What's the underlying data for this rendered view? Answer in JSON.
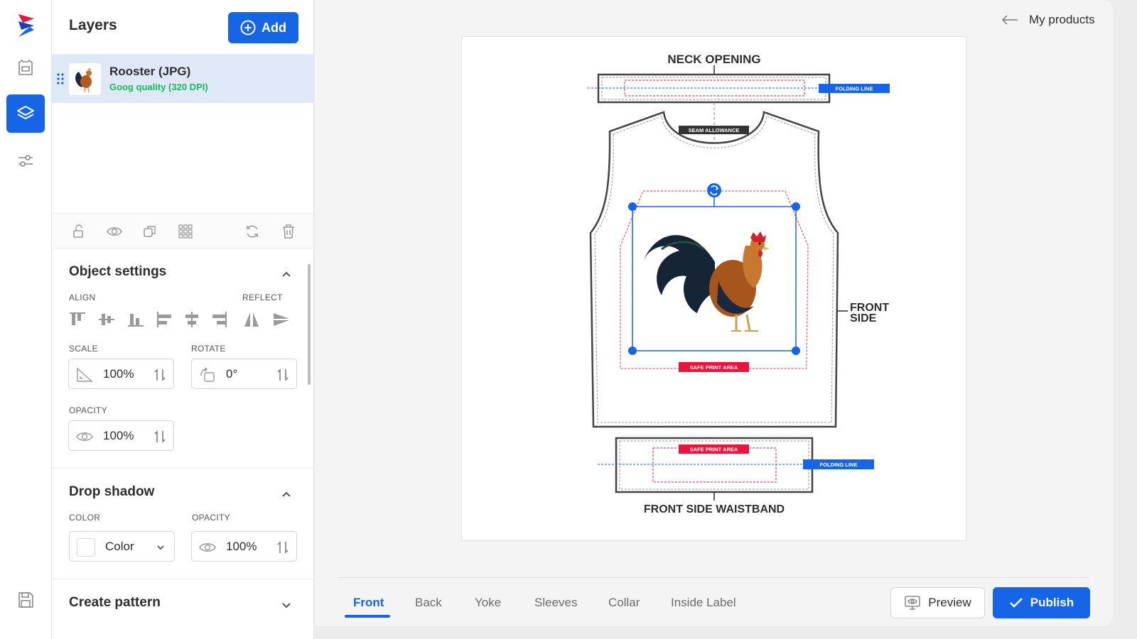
{
  "app": {
    "brand_colors": {
      "primary": "#1565e6",
      "accent_red": "#e8163c",
      "success": "#1bb954"
    }
  },
  "rail": {
    "items": [
      "logo",
      "products-icon",
      "layers-icon",
      "settings-sliders-icon",
      "save-icon"
    ],
    "active": "layers"
  },
  "layers": {
    "title": "Layers",
    "add_label": "Add",
    "items": [
      {
        "name": "Rooster (JPG)",
        "quality": "Goog quality (320 DPI)"
      }
    ]
  },
  "object_settings": {
    "title": "Object settings",
    "align_label": "ALIGN",
    "reflect_label": "REFLECT",
    "scale_label": "SCALE",
    "scale_value": "100%",
    "rotate_label": "ROTATE",
    "rotate_value": "0°",
    "opacity_label": "OPACITY",
    "opacity_value": "100%"
  },
  "drop_shadow": {
    "title": "Drop shadow",
    "color_label": "COLOR",
    "color_value": "Color",
    "opacity_label": "OPACITY",
    "opacity_value": "100%"
  },
  "create_pattern": {
    "title": "Create pattern"
  },
  "header": {
    "back_label": "My products"
  },
  "template": {
    "neck_opening": "NECK OPENING",
    "folding_line": "FOLDING LINE",
    "seam_allowance": "SEAM ALLOWANCE",
    "front_side_1": "FRONT",
    "front_side_2": "SIDE",
    "safe_print_area": "SAFE PRINT AREA",
    "waistband": "FRONT SIDE WAISTBAND"
  },
  "tabs": [
    "Front",
    "Back",
    "Yoke",
    "Sleeves",
    "Collar",
    "Inside Label"
  ],
  "active_tab": "Front",
  "actions": {
    "preview_label": "Preview",
    "publish_label": "Publish"
  }
}
